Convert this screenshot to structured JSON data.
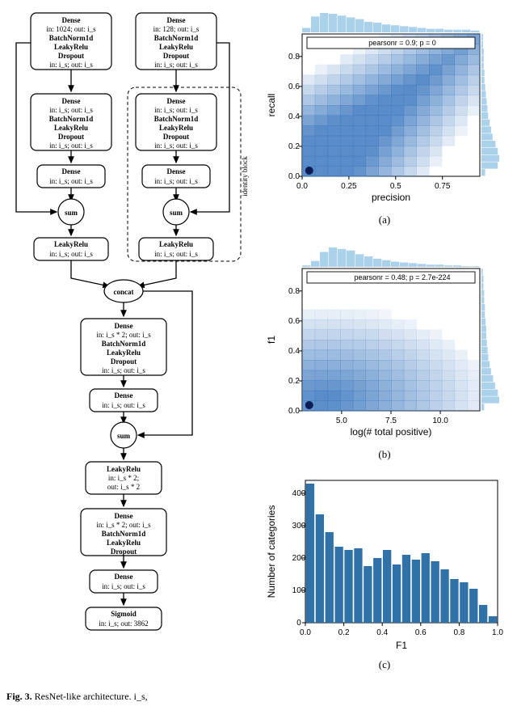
{
  "diagram": {
    "top_left": {
      "title": "Dense",
      "sub": "in: 1024; out: i_s",
      "l2": "BatchNorm1d",
      "l3": "LeakyRelu",
      "l4": "Dropout",
      "l5": "in: i_s; out: i_s"
    },
    "top_right": {
      "title": "Dense",
      "sub": "in: 128; out: i_s",
      "l2": "BatchNorm1d",
      "l3": "LeakyRelu",
      "l4": "Dropout",
      "l5": "in: i_s; out: i_s"
    },
    "mid_block_a": {
      "title": "Dense",
      "sub": "in: i_s; out: i_s",
      "l2": "BatchNorm1d",
      "l3": "LeakyRelu",
      "l4": "Dropout",
      "l5": "in: i_s; out: i_s"
    },
    "mid_block_b": {
      "title": "Dense",
      "sub": "in: i_s; out: i_s"
    },
    "sum": "sum",
    "leaky": {
      "title": "LeakyRelu",
      "sub": "in: i_s; out: i_s"
    },
    "concat": "concat",
    "big_block": {
      "title": "Dense",
      "sub": "in: i_s * 2; out: i_s",
      "l2": "BatchNorm1d",
      "l3": "LeakyRelu",
      "l4": "Dropout",
      "l5": "in: i_s; out: i_s"
    },
    "small_dense": {
      "title": "Dense",
      "sub": "in: i_s; out: i_s"
    },
    "leaky2": {
      "title": "LeakyRelu",
      "sub1": "in: i_s * 2;",
      "sub2": "out: i_s * 2"
    },
    "block4": {
      "title": "Dense",
      "sub": "in: i_s * 2; out: i_s",
      "l2": "BatchNorm1d",
      "l3": "LeakyRelu",
      "l4": "Dropout"
    },
    "block5": {
      "title": "Dense",
      "sub": "in: i_s; out: i_s"
    },
    "sigmoid": {
      "title": "Sigmoid",
      "sub": "in: i_s; out: 3862"
    },
    "identity_label": "identity block"
  },
  "fig3_caption_bold": "Fig. 3.",
  "fig3_caption_rest": " ResNet-like architecture. i_s,",
  "chart_data": [
    {
      "type": "jointplot-hex",
      "label": "(a)",
      "xlabel": "precision",
      "ylabel": "recall",
      "annotation": "pearsonr = 0.9; p = 0",
      "xticks": [
        0.0,
        0.25,
        0.5,
        0.75
      ],
      "yticks": [
        0.0,
        0.2,
        0.4,
        0.6,
        0.8
      ],
      "xlim": [
        0,
        0.95
      ],
      "ylim": [
        0,
        0.95
      ],
      "topHist": [
        5,
        18,
        22,
        21,
        19,
        17,
        15,
        12,
        11,
        9,
        8,
        7,
        6,
        5,
        4,
        4,
        3,
        3,
        3,
        2
      ],
      "rightHist": [
        5,
        22,
        24,
        22,
        19,
        15,
        13,
        11,
        9,
        8,
        7,
        6,
        5,
        4,
        4,
        3,
        3,
        3,
        2,
        2
      ]
    },
    {
      "type": "jointplot-hex",
      "label": "(b)",
      "xlabel": "log(# total positive)",
      "ylabel": "f1",
      "annotation": "pearsonr = 0.48; p = 2.7e-224",
      "xticks": [
        5.0,
        7.5,
        10.0
      ],
      "yticks": [
        0.0,
        0.2,
        0.4,
        0.6,
        0.8
      ],
      "xlim": [
        3,
        12
      ],
      "ylim": [
        0,
        0.95
      ],
      "topHist": [
        2,
        8,
        20,
        26,
        24,
        22,
        17,
        14,
        11,
        9,
        7,
        6,
        5,
        4,
        3,
        3,
        2,
        2,
        1,
        1
      ],
      "rightHist": [
        4,
        26,
        24,
        20,
        17,
        14,
        12,
        10,
        9,
        8,
        7,
        7,
        6,
        5,
        5,
        4,
        4,
        3,
        3,
        2
      ]
    },
    {
      "type": "bar",
      "label": "(c)",
      "xlabel": "F1",
      "ylabel": "Number of categories",
      "xticks": [
        0.0,
        0.2,
        0.4,
        0.6,
        0.8,
        1.0
      ],
      "yticks": [
        0,
        100,
        200,
        300,
        400
      ],
      "xlim": [
        0,
        1.0
      ],
      "ylim": [
        0,
        440
      ],
      "categories": [
        0.025,
        0.075,
        0.125,
        0.175,
        0.225,
        0.275,
        0.325,
        0.375,
        0.425,
        0.475,
        0.525,
        0.575,
        0.625,
        0.675,
        0.725,
        0.775,
        0.825,
        0.875,
        0.925,
        0.975
      ],
      "values": [
        430,
        335,
        280,
        235,
        225,
        230,
        175,
        200,
        225,
        180,
        210,
        195,
        215,
        190,
        165,
        135,
        125,
        105,
        55,
        20
      ]
    }
  ]
}
